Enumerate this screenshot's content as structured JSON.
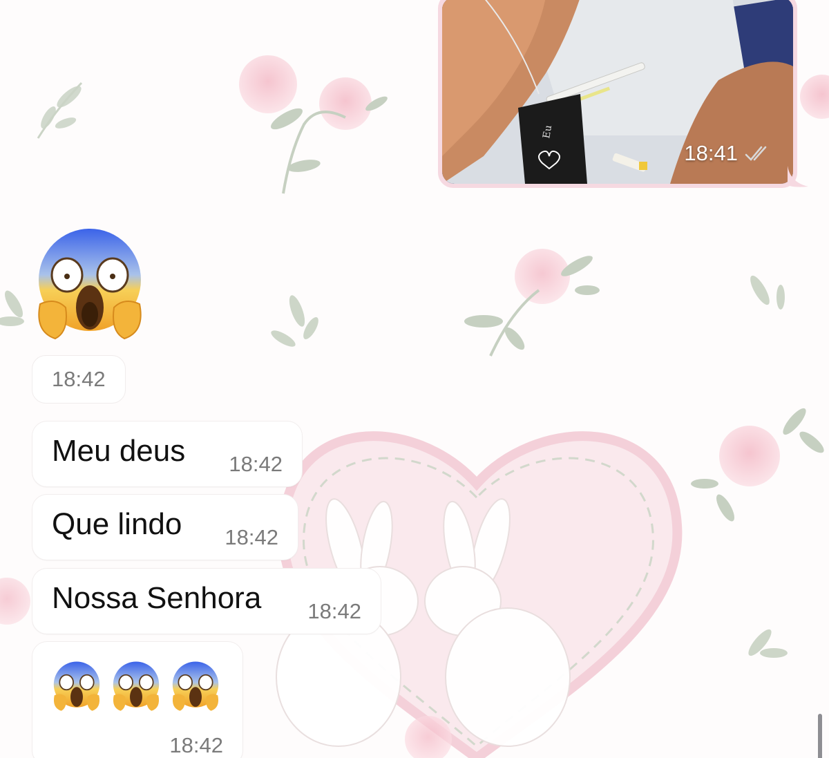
{
  "messages": {
    "outgoing_image": {
      "time": "18:41",
      "status_icon": "double-check-icon",
      "photo_caption_text": "Eu"
    },
    "big_emoji": {
      "emoji": "face-screaming-in-fear",
      "time": "18:42"
    },
    "text_messages": [
      {
        "text": "Meu deus",
        "time": "18:42"
      },
      {
        "text": "Que lindo",
        "time": "18:42"
      },
      {
        "text": "Nossa Senhora",
        "time": "18:42"
      }
    ],
    "emoji_message": {
      "emojis": [
        "face-screaming-in-fear",
        "face-screaming-in-fear",
        "face-screaming-in-fear"
      ],
      "time": "18:42"
    }
  },
  "colors": {
    "outgoing_bubble": "#f6d9e1",
    "incoming_bubble": "#ffffff",
    "wallpaper": "#fefcfc",
    "rose": "#f7cdd6",
    "leaf": "#c9d3c3",
    "timestamp": "#7a7a7a"
  }
}
